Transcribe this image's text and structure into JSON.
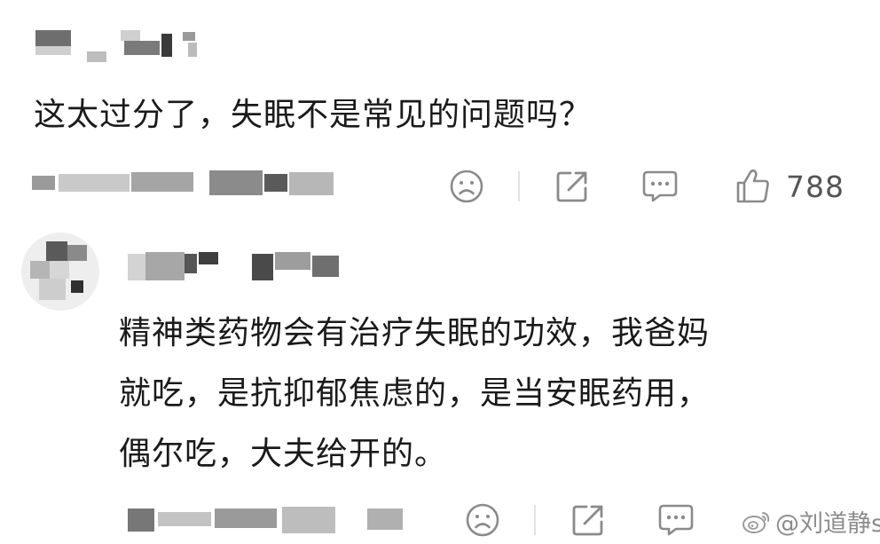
{
  "comments": [
    {
      "text": "这太过分了，失眠不是常见的问题吗？",
      "likes": "788",
      "actions": {
        "dislike_icon": "sad-face-icon",
        "share_icon": "share-icon",
        "reply_icon": "comment-icon",
        "like_icon": "thumbs-up-icon"
      }
    },
    {
      "lines": [
        "精神类药物会有治疗失眠的功效，我爸妈",
        "就吃，是抗抑郁焦虑的，是当安眠药用，",
        "偶尔吃，大夫给开的。"
      ],
      "actions": {
        "dislike_icon": "sad-face-icon",
        "share_icon": "share-icon",
        "reply_icon": "comment-icon"
      }
    }
  ],
  "watermark": {
    "text": "@刘道静ssr",
    "icon": "weibo-logo-icon"
  },
  "colors": {
    "icon_gray": "#8a8a8a",
    "text_dark": "#1a1a1a",
    "mosaic": [
      "#3a3a3a",
      "#6e6e6e",
      "#a9a9a9",
      "#d4d4d4"
    ]
  }
}
